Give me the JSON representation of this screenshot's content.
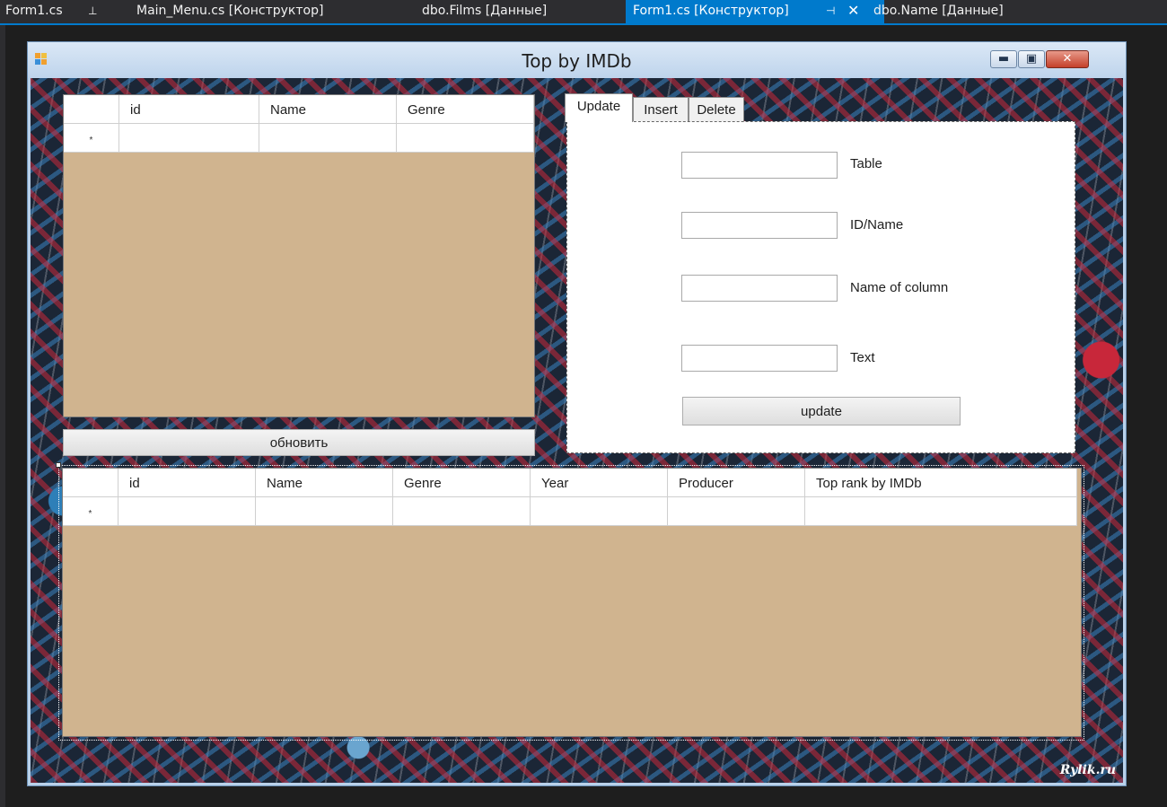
{
  "ide_tabs": [
    {
      "label": "Form1.cs"
    },
    {
      "label": "Main_Menu.cs [Конструктор]"
    },
    {
      "label": "dbo.Films [Данные]"
    },
    {
      "label": "Form1.cs [Конструктор]"
    },
    {
      "label": "dbo.Name [Данные]"
    }
  ],
  "window": {
    "title": "Top by IMDb",
    "watermark": "Rylik.ru"
  },
  "grid_top": {
    "columns": [
      "id",
      "Name",
      "Genre"
    ],
    "new_row_marker": "*"
  },
  "refresh_button": "обновить",
  "tabs": [
    "Update",
    "Insert",
    "Delete"
  ],
  "update_tab": {
    "fields": [
      {
        "label": "Table",
        "value": ""
      },
      {
        "label": "ID/Name",
        "value": ""
      },
      {
        "label": "Name of column",
        "value": ""
      },
      {
        "label": "Text",
        "value": ""
      }
    ],
    "button": "update"
  },
  "grid_bottom": {
    "columns": [
      "id",
      "Name",
      "Genre",
      "Year",
      "Producer",
      "Top rank by IMDb"
    ],
    "new_row_marker": "*"
  },
  "colors": {
    "ide_accent": "#007acc",
    "grid_background": "#d0b48f",
    "window_frame": "#b9d1ea"
  },
  "icons": [
    "app-icon",
    "pin-icon",
    "close-tab-icon",
    "minimize-icon",
    "maximize-icon",
    "close-icon"
  ]
}
